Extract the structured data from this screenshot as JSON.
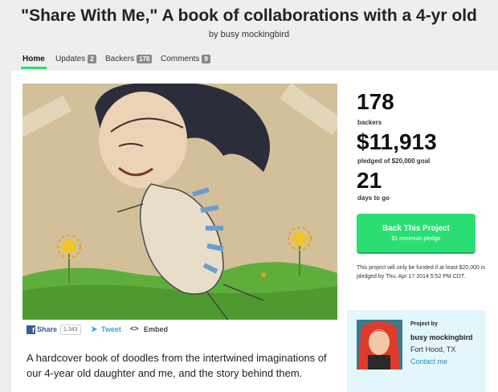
{
  "header": {
    "title": "\"Share With Me,\" A book of collaborations with a 4-yr old",
    "byline": "by busy mockingbird"
  },
  "tabs": [
    {
      "label": "Home",
      "active": true
    },
    {
      "label": "Updates",
      "count": "2"
    },
    {
      "label": "Backers",
      "count": "178"
    },
    {
      "label": "Comments",
      "count": "9"
    }
  ],
  "stats": {
    "backers_value": "178",
    "backers_label": "backers",
    "pledged_value": "$11,913",
    "pledged_label": "pledged of $20,000 goal",
    "days_value": "21",
    "days_label": "days to go"
  },
  "back_button": {
    "label": "Back This Project",
    "sublabel": "$1 minimum pledge",
    "color": "#2bde73"
  },
  "funding_note": "This project will only be funded if at least $20,000 is pledged by Thu, Apr 17 2014 5:52 PM CDT.",
  "social": {
    "share_label": "Share",
    "share_count": "1,343",
    "tweet_label": "Tweet",
    "embed_label": "Embed"
  },
  "blurb": "A hardcover book of doodles from the intertwined imaginations of our 4-year old daughter and me, and the story behind them.",
  "creator": {
    "heading": "Project by",
    "name": "busy mockingbird",
    "location": "Fort Hood, TX",
    "contact": "Contact me"
  },
  "icons": [
    "facebook-icon",
    "twitter-icon",
    "embed-icon"
  ]
}
